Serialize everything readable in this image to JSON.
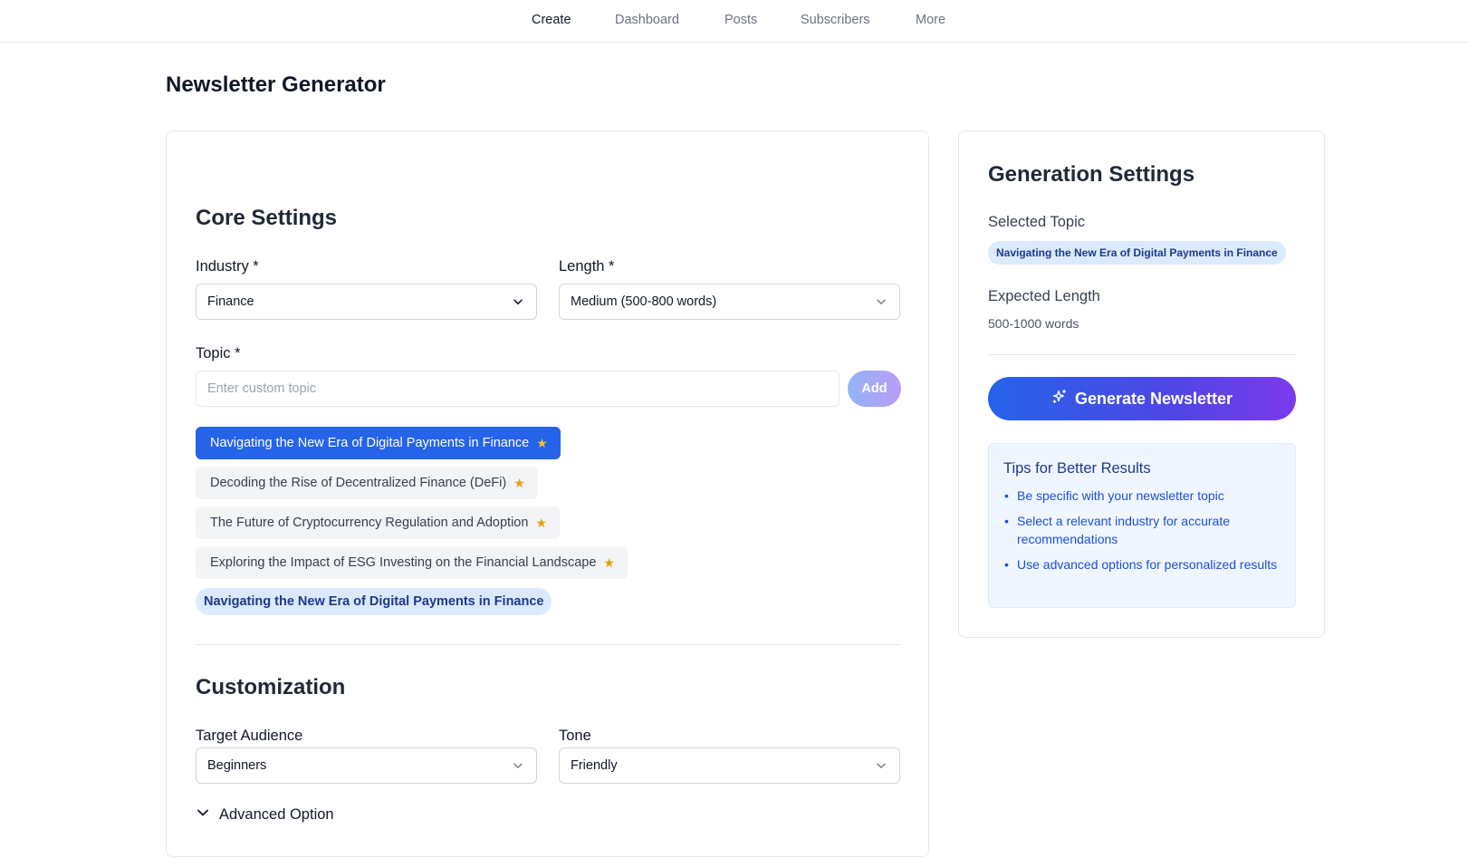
{
  "nav": {
    "items": [
      {
        "label": "Create",
        "active": true
      },
      {
        "label": "Dashboard",
        "active": false
      },
      {
        "label": "Posts",
        "active": false
      },
      {
        "label": "Subscribers",
        "active": false
      },
      {
        "label": "More",
        "active": false
      }
    ]
  },
  "page": {
    "title": "Newsletter Generator"
  },
  "core": {
    "title": "Core Settings",
    "industry": {
      "label": "Industry *",
      "value": "Finance"
    },
    "length": {
      "label": "Length *",
      "value": "Medium (500-800 words)"
    },
    "topic": {
      "label": "Topic *",
      "placeholder": "Enter custom topic",
      "value": "",
      "add_label": "Add"
    },
    "suggestions": [
      {
        "label": "Navigating the New Era of Digital Payments in Finance",
        "selected": true,
        "icon": "star-icon"
      },
      {
        "label": "Decoding the Rise of Decentralized Finance (DeFi)",
        "selected": false,
        "icon": "star-icon"
      },
      {
        "label": "The Future of Cryptocurrency Regulation and Adoption",
        "selected": false,
        "icon": "star-icon"
      },
      {
        "label": "Exploring the Impact of ESG Investing on the Financial Landscape",
        "selected": false,
        "icon": "star-icon"
      }
    ],
    "selected_topic_pill": "Navigating the New Era of Digital Payments in Finance"
  },
  "customization": {
    "title": "Customization",
    "audience": {
      "label": "Target Audience",
      "value": "Beginners"
    },
    "tone": {
      "label": "Tone",
      "value": "Friendly"
    },
    "advanced_label": "Advanced Option"
  },
  "side": {
    "title": "Generation Settings",
    "selected_topic_label": "Selected Topic",
    "selected_topic_value": "Navigating the New Era of Digital Payments in Finance",
    "expected_length_label": "Expected Length",
    "expected_length_value": "500-1000 words",
    "generate_label": "Generate Newsletter",
    "tips": {
      "title": "Tips for Better Results",
      "items": [
        "Be specific with your newsletter topic",
        "Select a relevant industry for accurate recommendations",
        "Use advanced options for personalized results"
      ]
    }
  },
  "colors": {
    "primary": "#2563eb",
    "accent_purple": "#7c3aed",
    "star": "#fbbf24",
    "pill_bg": "#dbeafe",
    "pill_text": "#1e3a8a",
    "tips_bg": "#eff6ff"
  }
}
